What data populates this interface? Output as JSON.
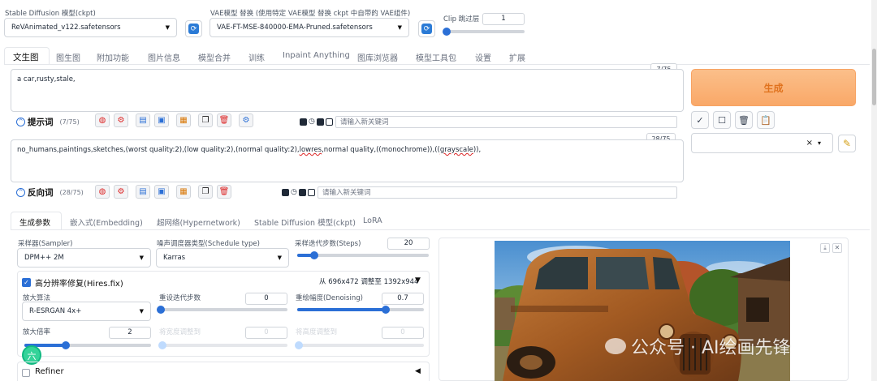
{
  "top": {
    "ckpt_label": "Stable Diffusion 模型(ckpt)",
    "ckpt_value": "ReVAnimated_v122.safetensors",
    "vae_label": "VAE模型 替换 (使用特定 VAE模型 替换 ckpt 中自带的 VAE组件)",
    "vae_value": "VAE-FT-MSE-840000-EMA-Pruned.safetensors",
    "clip_label": "Clip 跳过层",
    "clip_value": "1",
    "clip_fraction": 0.0
  },
  "tabs": [
    "文生图",
    "图生图",
    "附加功能",
    "图片信息",
    "模型合并",
    "训练",
    "Inpaint Anything",
    "图库浏览器",
    "模型工具包",
    "设置",
    "扩展"
  ],
  "prompt": {
    "text": "a car,rusty,stale,",
    "count": "7/75",
    "title": "提示词",
    "title_count": "(7/75)",
    "kw_placeholder": "请输入新关键词"
  },
  "negative": {
    "text_pre": "no_humans,paintings,sketches,(worst quality:2),(low quality:2),(normal quality:2),",
    "text_lowres": "lowres",
    "text_mid": ",normal  quality,((monochrome)),((",
    "text_gray": "grayscale",
    "text_post": ")),",
    "count": "28/75",
    "title": "反向词",
    "title_count": "(28/75)",
    "kw_placeholder": "请输入新关键词"
  },
  "generate": {
    "label": "生成"
  },
  "style_select": {
    "clear": "×",
    "caret": "▾"
  },
  "subtabs": [
    "生成参数",
    "嵌入式(Embedding)",
    "超网络(Hypernetwork)",
    "Stable Diffusion 模型(ckpt)",
    "LoRA"
  ],
  "params": {
    "sampler_label": "采样器(Sampler)",
    "sampler_value": "DPM++ 2M",
    "schedule_label": "噪声调度器类型(Schedule type)",
    "schedule_value": "Karras",
    "steps_label": "采样迭代步数(Steps)",
    "steps_value": "20",
    "steps_fraction": 0.13
  },
  "hires": {
    "title": "高分辨率修复(Hires.fix)",
    "info": "从 696x472  调整至 1392x944",
    "upscaler_label": "放大算法",
    "upscaler_value": "R-ESRGAN 4x+",
    "hr_steps_label": "重设迭代步数",
    "hr_steps_value": "0",
    "hr_steps_fraction": 0.0,
    "denoise_label": "重绘幅度(Denoising)",
    "denoise_value": "0.7",
    "denoise_fraction": 0.7,
    "scale_label": "放大倍率",
    "scale_value": "2",
    "scale_fraction": 0.33,
    "width_label": "将宽度调整到",
    "width_value": "0",
    "height_label": "将高度调整到",
    "height_value": "0"
  },
  "refiner": {
    "label": "Refiner"
  },
  "watermark": {
    "text": "公众号 · AI绘画先锋",
    "badge": "六"
  },
  "colors": {
    "accent": "#2b6fd6",
    "generate": "#f9a868",
    "generate_text": "#e0731f"
  }
}
